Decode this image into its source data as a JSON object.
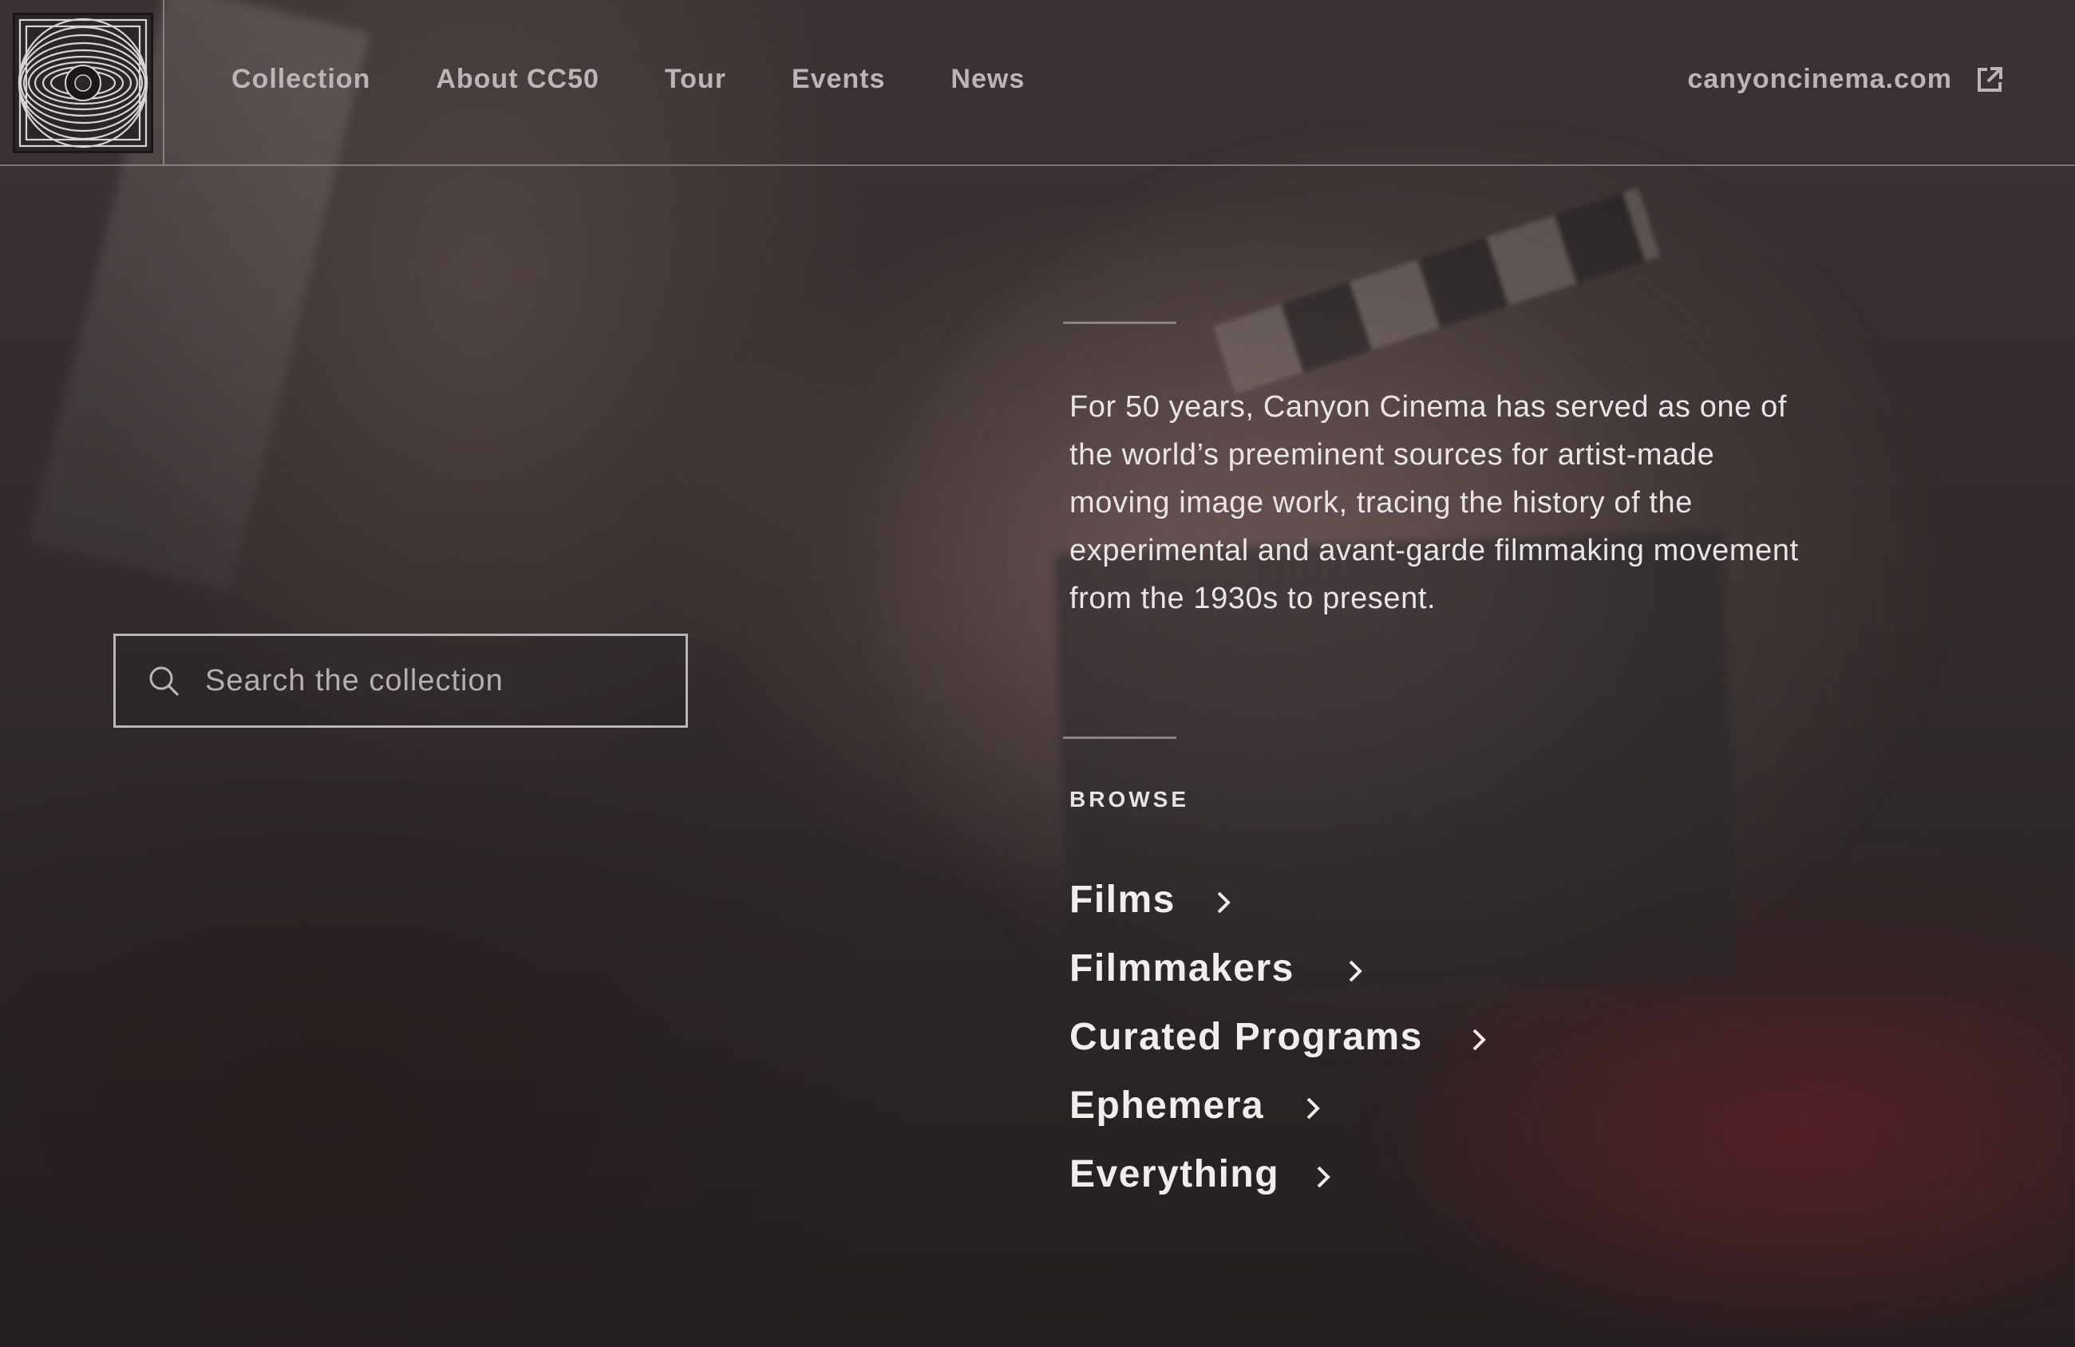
{
  "header": {
    "logo_icon": "canyon-cinema-eye-logo",
    "nav": [
      {
        "label": "Collection"
      },
      {
        "label": "About CC50"
      },
      {
        "label": "Tour"
      },
      {
        "label": "Events"
      },
      {
        "label": "News"
      }
    ],
    "external_link": {
      "label": "canyoncinema.com",
      "icon": "external-link-icon"
    }
  },
  "search": {
    "placeholder": "Search the collection",
    "value": "",
    "icon": "search-icon"
  },
  "intro": {
    "text": "For 50 years, Canyon Cinema has served as one of the world’s preeminent sources for artist-made moving image work, tracing the history of the experimental and avant-garde filmmaking movement from the 1930s to present."
  },
  "browse": {
    "heading": "BROWSE",
    "items": [
      {
        "label": "Films",
        "icon": "chevron-right-icon"
      },
      {
        "label": "Filmmakers",
        "icon": "chevron-right-icon"
      },
      {
        "label": "Curated Programs",
        "icon": "chevron-right-icon"
      },
      {
        "label": "Ephemera",
        "icon": "chevron-right-icon"
      },
      {
        "label": "Everything",
        "icon": "chevron-right-icon"
      }
    ]
  },
  "colors": {
    "text_primary": "#f1eded",
    "text_nav": "#bcb5b5",
    "divider": "#8c8484",
    "background": "#2d2626"
  }
}
